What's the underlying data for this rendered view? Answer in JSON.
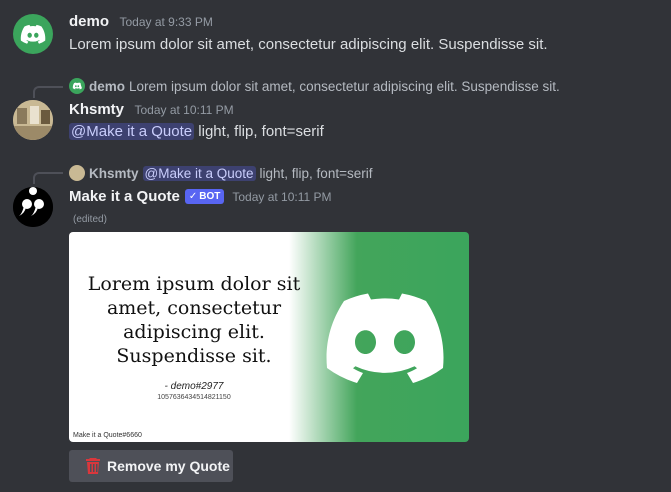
{
  "messages": [
    {
      "author": "demo",
      "timestamp": "Today at 9:33 PM",
      "text": "Lorem ipsum dolor sit amet, consectetur adipiscing elit. Suspendisse sit."
    },
    {
      "reply": {
        "author": "demo",
        "text": "Lorem ipsum dolor sit amet, consectetur adipiscing elit. Suspendisse sit."
      },
      "author": "Khsmty",
      "timestamp": "Today at 10:11 PM",
      "mention": "@Make it a Quote",
      "text": "light, flip, font=serif"
    },
    {
      "reply": {
        "author": "Khsmty",
        "mention": "@Make it a Quote",
        "text": "light, flip, font=serif"
      },
      "author": "Make it a Quote",
      "bot_tag": "BOT",
      "timestamp": "Today at 10:11 PM",
      "edited": "(edited)",
      "quote_image": {
        "quote": "Lorem ipsum dolor sit amet, consectetur adipiscing elit. Suspendisse sit.",
        "attribution": "- demo#2977",
        "user_id": "1057636434514821150",
        "footer": "Make it a Quote#6660"
      },
      "button_label": "Remove my Quote"
    }
  ],
  "colors": {
    "background": "#313338",
    "discord_green": "#3ba55c",
    "blurple": "#5865f2",
    "trash_red": "#da373c"
  }
}
